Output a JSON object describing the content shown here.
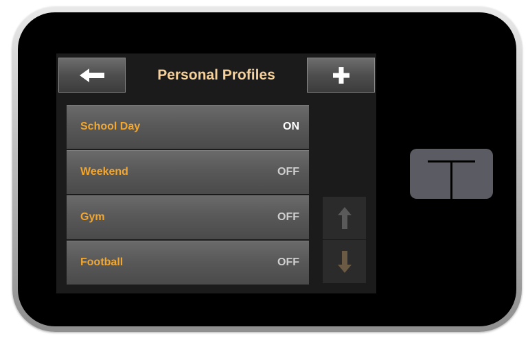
{
  "header": {
    "title": "Personal Profiles",
    "back_icon": "back-arrow-icon",
    "add_icon": "plus-icon"
  },
  "profiles": [
    {
      "name": "School Day",
      "status": "ON"
    },
    {
      "name": "Weekend",
      "status": "OFF"
    },
    {
      "name": "Gym",
      "status": "OFF"
    },
    {
      "name": "Football",
      "status": "OFF"
    }
  ],
  "scroll": {
    "up_icon": "arrow-up-icon",
    "down_icon": "arrow-down-icon"
  },
  "device": {
    "logo_icon": "t-logo-icon"
  },
  "colors": {
    "title": "#f6d099",
    "profile_name": "#f3a72e",
    "status_on": "#ffffff",
    "status_off": "#cfcfcf",
    "screen_bg": "#1b1b1b"
  }
}
